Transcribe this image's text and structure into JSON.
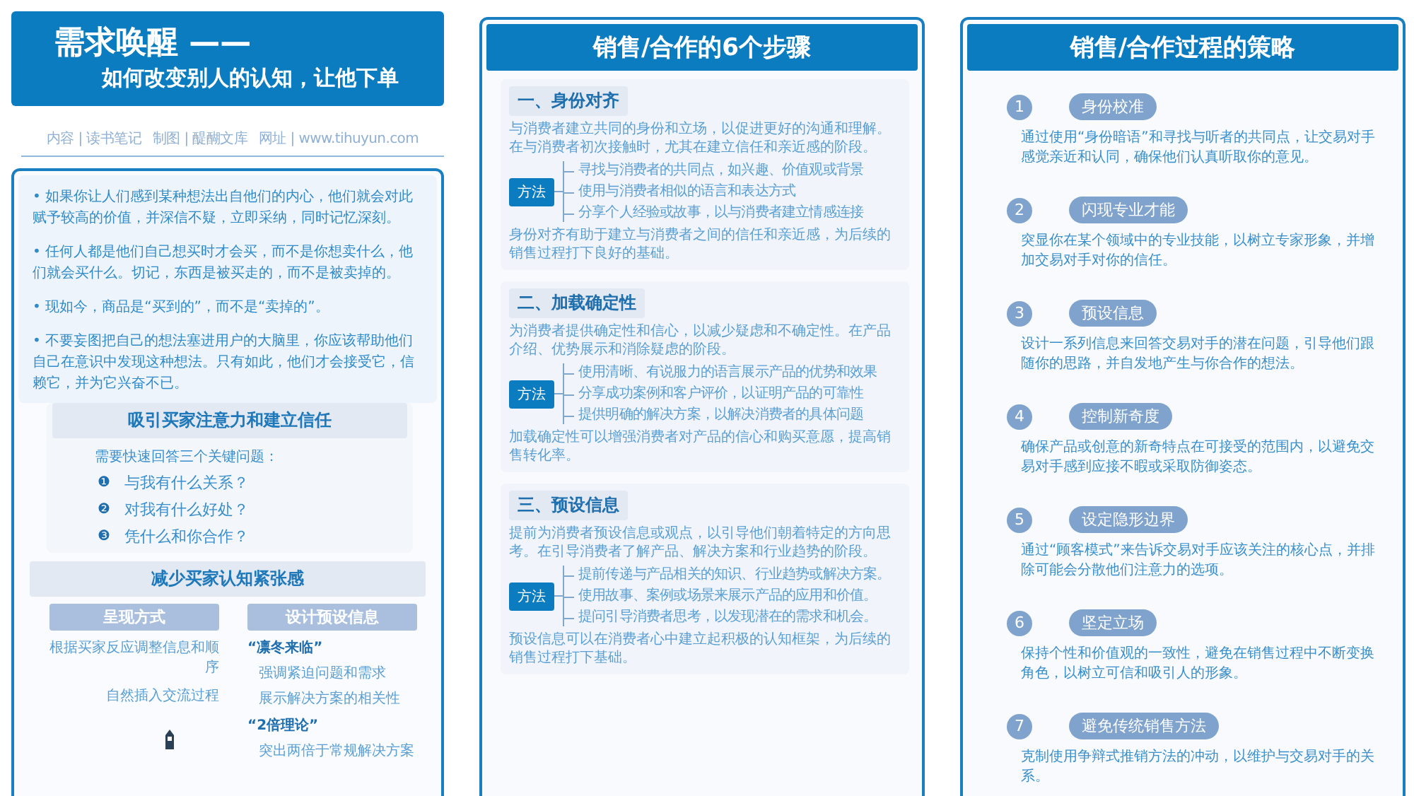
{
  "header": {
    "title": "需求唤醒 ——",
    "subtitle": "如何改变别人的认知，让他下单"
  },
  "credits": [
    "内容 | 读书笔记",
    "制图 | 醍醐文库",
    "网址 | www.tihuyun.com"
  ],
  "insights": [
    "• 如果你让人们感到某种想法出自他们的内心，他们就会对此赋予较高的价值，并深信不疑，立即采纳，同时记忆深刻。",
    "• 任何人都是他们自己想买时才会买，而不是你想卖什么，他们就会买什么。切记，东西是被买走的，而不是被卖掉的。",
    "• 现如今，商品是“买到的”，而不是“卖掉的”。",
    "• 不要妄图把自己的想法塞进用户的大脑里，你应该帮助他们自己在意识中发现这种想法。只有如此，他们才会接受它，信赖它，并为它兴奋不已。"
  ],
  "trust_section": {
    "title": "吸引买家注意力和建立信任",
    "intro": "需要快速回答三个关键问题：",
    "questions": [
      {
        "marker": "❶",
        "text": "与我有什么关系？"
      },
      {
        "marker": "❷",
        "text": "对我有什么好处？"
      },
      {
        "marker": "❸",
        "text": "凭什么和你合作？"
      }
    ]
  },
  "tension_section": {
    "title": "减少买家认知紧张感",
    "presentation": {
      "title": "呈现方式",
      "items": [
        "根据买家反应调整信息和顺序",
        "自然插入交流过程"
      ]
    },
    "preset": {
      "title": "设计预设信息",
      "groups": [
        {
          "heading": "“凛冬来临”",
          "items": [
            "强调紧迫问题和需求",
            "展示解决方案的相关性"
          ]
        },
        {
          "heading": "“2倍理论”",
          "items": [
            "突出两倍于常规解决方案"
          ]
        }
      ]
    }
  },
  "steps": {
    "title": "销售/合作的6个步骤",
    "sections": [
      {
        "title": "一、身份对齐",
        "intro": "与消费者建立共同的身份和立场，以促进更好的沟通和理解。在与消费者初次接触时，尤其在建立信任和亲近感的阶段。",
        "method_label": "方法",
        "methods": [
          "寻找与消费者的共同点，如兴趣、价值观或背景",
          "使用与消费者相似的语言和表达方式",
          "分享个人经验或故事，以与消费者建立情感连接"
        ],
        "conclusion": "身份对齐有助于建立与消费者之间的信任和亲近感，为后续的销售过程打下良好的基础。"
      },
      {
        "title": "二、加载确定性",
        "intro": "为消费者提供确定性和信心，以减少疑虑和不确定性。在产品介绍、优势展示和消除疑虑的阶段。",
        "method_label": "方法",
        "methods": [
          "使用清晰、有说服力的语言展示产品的优势和效果",
          "分享成功案例和客户评价，以证明产品的可靠性",
          "提供明确的解决方案，以解决消费者的具体问题"
        ],
        "conclusion": "加载确定性可以增强消费者对产品的信心和购买意愿，提高销售转化率。"
      },
      {
        "title": "三、预设信息",
        "intro": "提前为消费者预设信息或观点，以引导他们朝着特定的方向思考。在引导消费者了解产品、解决方案和行业趋势的阶段。",
        "method_label": "方法",
        "methods": [
          "提前传递与产品相关的知识、行业趋势或解决方案。",
          "使用故事、案例或场景来展示产品的应用和价值。",
          "提问引导消费者思考，以发现潜在的需求和机会。"
        ],
        "conclusion": "预设信息可以在消费者心中建立起积极的认知框架，为后续的销售过程打下基础。"
      }
    ]
  },
  "strategies": {
    "title": "销售/合作过程的策略",
    "items": [
      {
        "number": "1",
        "title": "身份校准",
        "description": "通过使用“身份暗语”和寻找与听者的共同点，让交易对手感觉亲近和认同，确保他们认真听取你的意见。"
      },
      {
        "number": "2",
        "title": "闪现专业才能",
        "description": "突显你在某个领域中的专业技能，以树立专家形象，并增加交易对手对你的信任。"
      },
      {
        "number": "3",
        "title": "预设信息",
        "description": "设计一系列信息来回答交易对手的潜在问题，引导他们跟随你的思路，并自发地产生与你合作的想法。"
      },
      {
        "number": "4",
        "title": "控制新奇度",
        "description": "确保产品或创意的新奇特点在可接受的范围内，以避免交易对手感到应接不暇或采取防御姿态。"
      },
      {
        "number": "5",
        "title": "设定隐形边界",
        "description": "通过“顾客模式”来告诉交易对手应该关注的核心点，并排除可能会分散他们注意力的选项。"
      },
      {
        "number": "6",
        "title": "坚定立场",
        "description": "保持个性和价值观的一致性，避免在销售过程中不断变换角色，以树立可信和吸引人的形象。"
      },
      {
        "number": "7",
        "title": "避免传统销售方法",
        "description": "克制使用争辩式推销方法的冲动，以维护与交易对手的关系。"
      }
    ]
  }
}
